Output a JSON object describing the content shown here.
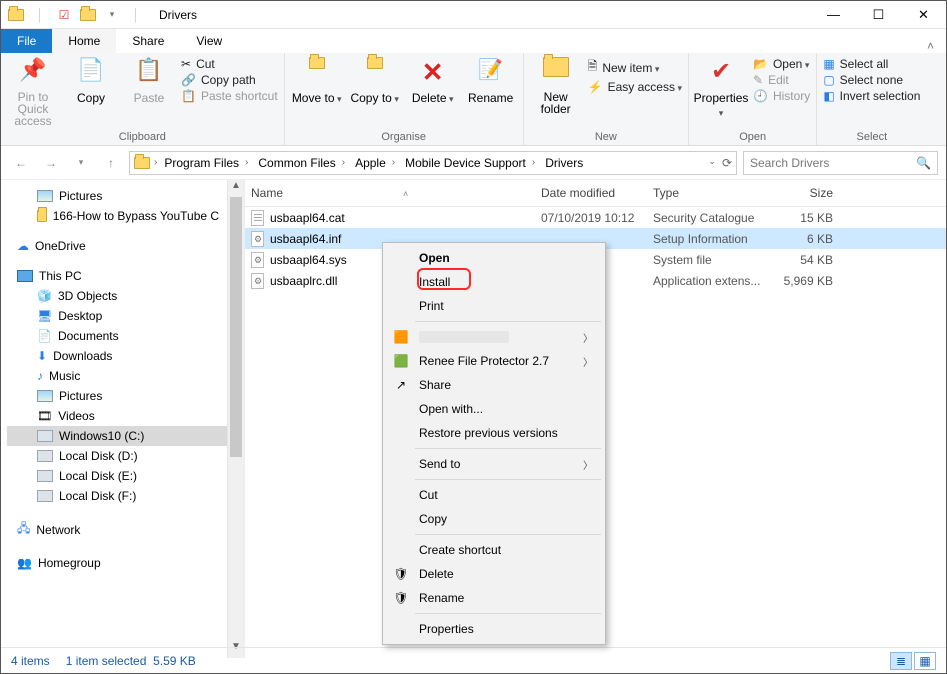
{
  "window": {
    "title": "Drivers"
  },
  "tabs": {
    "file": "File",
    "home": "Home",
    "share": "Share",
    "view": "View"
  },
  "ribbon": {
    "clipboard": {
      "label": "Clipboard",
      "pin": "Pin to Quick access",
      "copy": "Copy",
      "paste": "Paste",
      "cut": "Cut",
      "copypath": "Copy path",
      "pasteshort": "Paste shortcut"
    },
    "organise": {
      "label": "Organise",
      "moveto": "Move to",
      "copyto": "Copy to",
      "delete": "Delete",
      "rename": "Rename"
    },
    "new": {
      "label": "New",
      "newfolder": "New folder",
      "newitem": "New item",
      "easyaccess": "Easy access"
    },
    "open": {
      "label": "Open",
      "properties": "Properties",
      "open": "Open",
      "edit": "Edit",
      "history": "History"
    },
    "select": {
      "label": "Select",
      "selectall": "Select all",
      "selectnone": "Select none",
      "invert": "Invert selection"
    }
  },
  "breadcrumb": [
    "Program Files",
    "Common Files",
    "Apple",
    "Mobile Device Support",
    "Drivers"
  ],
  "search": {
    "placeholder": "Search Drivers"
  },
  "nav": {
    "quick": [
      {
        "label": "Pictures",
        "icon": "pic"
      },
      {
        "label": "166-How to Bypass YouTube C",
        "icon": "folder"
      }
    ],
    "onedrive": "OneDrive",
    "thispc": "This PC",
    "pcchildren": [
      {
        "label": "3D Objects",
        "icon": "folder"
      },
      {
        "label": "Desktop",
        "icon": "folder"
      },
      {
        "label": "Documents",
        "icon": "folder"
      },
      {
        "label": "Downloads",
        "icon": "folder"
      },
      {
        "label": "Music",
        "icon": "folder"
      },
      {
        "label": "Pictures",
        "icon": "pic"
      },
      {
        "label": "Videos",
        "icon": "folder"
      },
      {
        "label": "Windows10 (C:)",
        "icon": "disk",
        "selected": true
      },
      {
        "label": "Local Disk (D:)",
        "icon": "disk"
      },
      {
        "label": "Local Disk (E:)",
        "icon": "disk"
      },
      {
        "label": "Local Disk (F:)",
        "icon": "disk"
      }
    ],
    "network": "Network",
    "homegroup": "Homegroup"
  },
  "columns": {
    "name": "Name",
    "date": "Date modified",
    "type": "Type",
    "size": "Size"
  },
  "files": [
    {
      "name": "usbaapl64.cat",
      "date": "07/10/2019 10:12",
      "type": "Security Catalogue",
      "size": "15 KB",
      "icon": "cert"
    },
    {
      "name": "usbaapl64.inf",
      "date": "",
      "type": "Setup Information",
      "size": "6 KB",
      "icon": "inf",
      "selected": true
    },
    {
      "name": "usbaapl64.sys",
      "date": "",
      "type": "System file",
      "size": "54 KB",
      "icon": "sys"
    },
    {
      "name": "usbaaplrc.dll",
      "date": "",
      "type": "Application extens...",
      "size": "5,969 KB",
      "icon": "dll"
    }
  ],
  "context": {
    "open": "Open",
    "install": "Install",
    "print": "Print",
    "rfp": "Renee File Protector 2.7",
    "share": "Share",
    "openwith": "Open with...",
    "restore": "Restore previous versions",
    "sendto": "Send to",
    "cut": "Cut",
    "copy": "Copy",
    "createshortcut": "Create shortcut",
    "delete": "Delete",
    "rename": "Rename",
    "properties": "Properties"
  },
  "status": {
    "count": "4 items",
    "sel": "1 item selected",
    "size": "5.59 KB"
  }
}
